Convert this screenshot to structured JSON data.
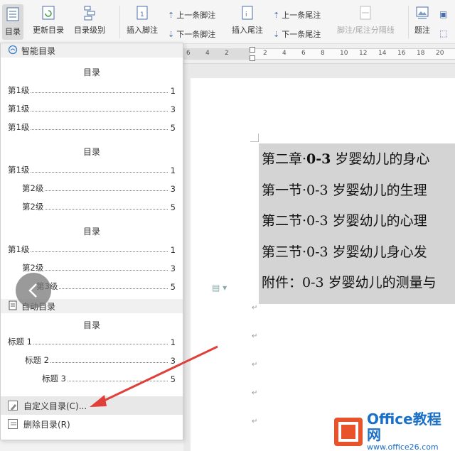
{
  "ribbon": {
    "toc_label": "目录",
    "update_toc_label": "更新目录",
    "toc_level_label": "目录级别",
    "insert_footnote_label": "插入脚注",
    "prev_footnote_label": "上一条脚注",
    "next_footnote_label": "下一条脚注",
    "insert_endnote_label": "插入尾注",
    "prev_endnote_label": "上一条尾注",
    "next_endnote_label": "下一条尾注",
    "separator_label": "脚注/尾注分隔线",
    "caption_label": "题注"
  },
  "ruler": {
    "ticks": [
      "6",
      "4",
      "2",
      "",
      "2",
      "4",
      "6",
      "8",
      "10",
      "12",
      "14",
      "16",
      "18",
      "20"
    ]
  },
  "panel": {
    "smart_toc_header": "智能目录",
    "templates": [
      {
        "title": "目录",
        "entries": [
          {
            "label": "第1级",
            "page": "1"
          },
          {
            "label": "第1级",
            "page": "3"
          },
          {
            "label": "第1级",
            "page": "5"
          }
        ]
      },
      {
        "title": "目录",
        "entries": [
          {
            "label": "第1级",
            "page": "1"
          },
          {
            "label": "第2级",
            "page": "3"
          },
          {
            "label": "第2级",
            "page": "5"
          }
        ]
      },
      {
        "title": "目录",
        "entries": [
          {
            "label": "第1级",
            "page": "1"
          },
          {
            "label": "第2级",
            "page": "3"
          },
          {
            "label": "第3级",
            "page": "5"
          }
        ]
      }
    ],
    "auto_toc_header": "自动目录",
    "auto_template": {
      "title": "目录",
      "entries": [
        {
          "label": "标题 1",
          "page": "1"
        },
        {
          "label": "标题 2",
          "page": "3"
        },
        {
          "label": "标题 3",
          "page": "5"
        }
      ]
    },
    "custom_toc_label": "自定义目录(C)...",
    "delete_toc_label": "删除目录(R)"
  },
  "document": {
    "lines": [
      {
        "prefix": "第二章·",
        "bold": "0-3",
        "rest": " 岁婴幼儿的身心"
      },
      {
        "prefix": "第一节·",
        "bold": "",
        "rest": "0-3 岁婴幼儿的生理"
      },
      {
        "prefix": "第二节·",
        "bold": "",
        "rest": "0-3 岁婴幼儿的心理"
      },
      {
        "prefix": "第三节·",
        "bold": "",
        "rest": "0-3 岁婴幼儿身心发"
      },
      {
        "prefix": "附件：",
        "bold": "",
        "rest": "0-3 岁婴幼儿的测量与"
      }
    ],
    "paragraph_mark": "↵"
  },
  "watermark": {
    "brand": "Office教程网",
    "url": "www.office26.com"
  },
  "colors": {
    "arrow": "#e0403a",
    "toc_highlight": "#d4d4d4",
    "watermark_blue": "#1a6fc9",
    "watermark_orange": "#e8532b"
  }
}
